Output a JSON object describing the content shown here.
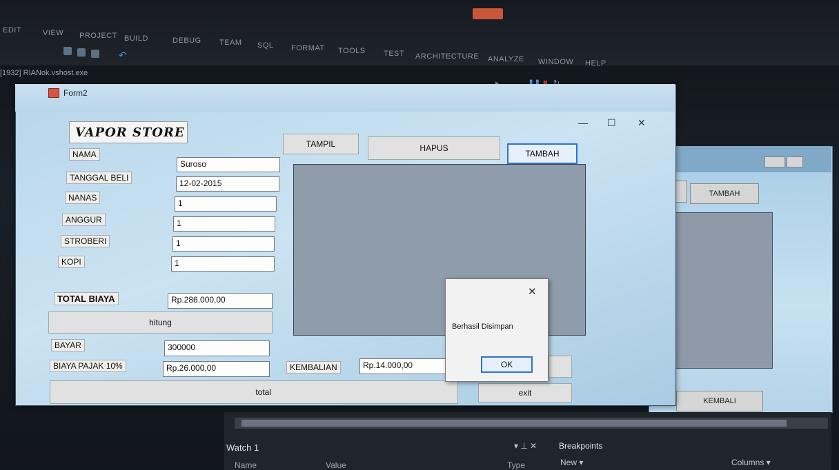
{
  "ide": {
    "menu": [
      "EDIT",
      "VIEW",
      "PROJECT",
      "BUILD",
      "DEBUG",
      "TEAM",
      "SQL",
      "FORMAT",
      "TOOLS",
      "TEST",
      "ARCHITECTURE",
      "ANALYZE",
      "WINDOW",
      "HELP"
    ],
    "process": "[1932] RIANok.vshost.exe",
    "watch_title": "Watch 1",
    "watch_columns": [
      "Name",
      "Value",
      "Type"
    ],
    "breakpoints_title": "Breakpoints",
    "bp_new": "New ▾",
    "bp_columns": "Columns ▾"
  },
  "bg_form": {
    "tambah": "TAMBAH",
    "kembali": "KEMBALI"
  },
  "form2": {
    "title": "Form2",
    "logo": "VAPOR STORE",
    "labels": {
      "nama": "NAMA",
      "tanggal": "TANGGAL BELI",
      "nanas": "NANAS",
      "anggur": "ANGGUR",
      "stroberi": "STROBERI",
      "kopi": "KOPI",
      "total_biaya": "TOTAL BIAYA",
      "bayar": "BAYAR",
      "pajak": "BIAYA PAJAK 10%",
      "kembalian": "KEMBALIAN"
    },
    "values": {
      "nama": "Suroso",
      "tanggal": "12-02-2015",
      "nanas": "1",
      "anggur": "1",
      "stroberi": "1",
      "kopi": "1",
      "total_biaya": "Rp.286.000,00",
      "bayar": "300000",
      "pajak": "Rp.26.000,00",
      "kembalian": "Rp.14.000,00"
    },
    "buttons": {
      "tampil": "TAMPIL",
      "hapus": "HAPUS",
      "tambah": "TAMBAH",
      "hitung": "hitung",
      "total": "total",
      "exit": "exit"
    }
  },
  "msgbox": {
    "text": "Berhasil Disimpan",
    "ok": "OK"
  }
}
